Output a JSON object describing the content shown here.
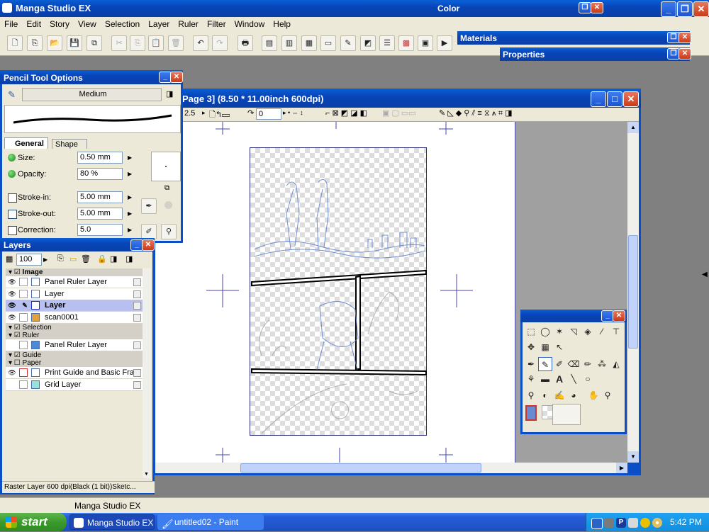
{
  "app": {
    "title": "Manga Studio EX"
  },
  "menu": [
    "File",
    "Edit",
    "Story",
    "View",
    "Selection",
    "Layer",
    "Ruler",
    "Filter",
    "Window",
    "Help"
  ],
  "floating_bars": {
    "color": "Color",
    "materials": "Materials",
    "properties": "Properties"
  },
  "pencil": {
    "title": "Pencil Tool Options",
    "preset": "Medium",
    "tabs": [
      "General",
      "Shape"
    ],
    "size_label": "Size:",
    "size_value": "0.50 mm",
    "opacity_label": "Opacity:",
    "opacity_value": "80 %",
    "strokein_label": "Stroke-in:",
    "strokein_value": "5.00 mm",
    "strokeout_label": "Stroke-out:",
    "strokeout_value": "5.00 mm",
    "correction_label": "Correction:",
    "correction_value": "5.0"
  },
  "layers": {
    "title": "Layers",
    "opacity": "100",
    "groups": {
      "image": "Image",
      "selection": "Selection",
      "ruler": "Ruler",
      "guide": "Guide",
      "paper": "Paper"
    },
    "items": [
      {
        "name": "Panel Ruler Layer"
      },
      {
        "name": "Layer"
      },
      {
        "name": "Layer"
      },
      {
        "name": "scan0001"
      },
      {
        "name": "Panel Ruler Layer"
      },
      {
        "name": "Print Guide and Basic Fra..."
      },
      {
        "name": "Grid Layer"
      }
    ],
    "status": "Raster Layer 600 dpi(Black (1 bit))Sketc..."
  },
  "document": {
    "title": "Page 3] (8.50 * 11.00inch 600dpi)",
    "zoom": "2.5",
    "rotation": "0"
  },
  "status_bar": "Manga Studio EX",
  "taskbar": {
    "start": "start",
    "tasks": [
      "Manga Studio EX",
      "untitled02 - Paint"
    ],
    "clock": "5:42 PM"
  },
  "colors": {
    "xp_blue": "#0a4fc8",
    "taskbar": "#245edb",
    "start": "#3c9a2c",
    "selected_layer": "#b8c0f0"
  }
}
